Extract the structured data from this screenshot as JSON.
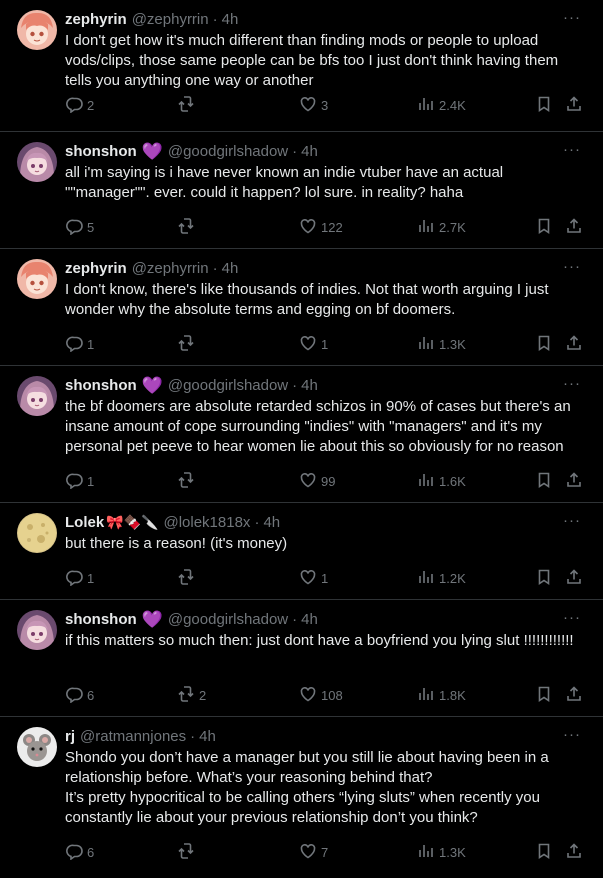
{
  "icons": {
    "reply": "reply-icon",
    "retweet": "retweet-icon",
    "like": "heart-icon",
    "views": "views-icon",
    "bookmark": "bookmark-icon",
    "share": "share-icon",
    "more": "more-icon"
  },
  "colors": {
    "background": "#000000",
    "text": "#e7e9ea",
    "muted": "#71767b",
    "border": "#2f3336",
    "heart": "#9b72cf"
  },
  "tweets": [
    {
      "name": "zephyrin",
      "handle": "@zephyrrin",
      "sep": "·",
      "time": "4h",
      "badge": "",
      "more": "···",
      "text": "I don't get how it's much different than finding mods or people to upload vods/clips, those same people can be bfs too I just don't think having them tells you anything one way or another",
      "replies": "2",
      "retweets": "",
      "likes": "3",
      "views": "2.4K"
    },
    {
      "name": "shonshon",
      "handle": "@goodgirlshadow",
      "sep": "·",
      "time": "4h",
      "badge": "💜",
      "more": "···",
      "text": "all i'm saying is i have never known an indie vtuber have an actual \"\"manager\"\". ever. could it happen? lol sure. in reality? haha",
      "replies": "5",
      "retweets": "",
      "likes": "122",
      "views": "2.7K"
    },
    {
      "name": "zephyrin",
      "handle": "@zephyrrin",
      "sep": "·",
      "time": "4h",
      "badge": "",
      "more": "···",
      "text": "I don't know, there's like thousands of indies. Not that worth arguing I just wonder why the absolute terms and egging on bf doomers.",
      "replies": "1",
      "retweets": "",
      "likes": "1",
      "views": "1.3K"
    },
    {
      "name": "shonshon",
      "handle": "@goodgirlshadow",
      "sep": "·",
      "time": "4h",
      "badge": "💜",
      "more": "···",
      "text": "the bf doomers are absolute retarded schizos in 90% of cases but there's an insane amount of cope surrounding \"indies\" with \"managers\" and it's my personal pet peeve to hear women lie about this so obviously for no reason",
      "replies": "1",
      "retweets": "",
      "likes": "99",
      "views": "1.6K"
    },
    {
      "name": "Lolek",
      "handle": "@lolek1818x",
      "sep": "·",
      "time": "4h",
      "badge": "🎀🍫🔪",
      "more": "···",
      "text": "but there is a reason! (it's money)",
      "replies": "1",
      "retweets": "",
      "likes": "1",
      "views": "1.2K"
    },
    {
      "name": "shonshon",
      "handle": "@goodgirlshadow",
      "sep": "·",
      "time": "4h",
      "badge": "💜",
      "more": "···",
      "text": "if this matters so much then: just dont have a boyfriend you lying slut !!!!!!!!!!!!",
      "replies": "6",
      "retweets": "2",
      "likes": "108",
      "views": "1.8K"
    },
    {
      "name": "rj",
      "handle": "@ratmannjones",
      "sep": "·",
      "time": "4h",
      "badge": "",
      "more": "···",
      "text": "Shondo you don’t have a manager but you still lie about having been in a relationship before. What’s your reasoning behind that?\nIt’s pretty hypocritical to be calling others “lying sluts” when recently you constantly lie about your previous relationship don’t you think?",
      "replies": "6",
      "retweets": "",
      "likes": "7",
      "views": "1.3K"
    }
  ]
}
